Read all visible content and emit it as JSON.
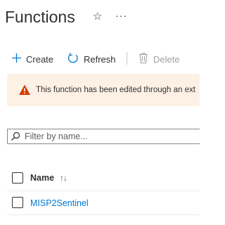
{
  "page": {
    "title": "Functions",
    "favorite_icon": "star-icon",
    "more_icon": "ellipsis-icon",
    "more_glyph": "···"
  },
  "toolbar": {
    "create_label": "Create",
    "refresh_label": "Refresh",
    "delete_label": "Delete",
    "delete_enabled": false
  },
  "banner": {
    "icon": "warning-icon",
    "text": "This function has been edited through an ext",
    "color": "#fdf1e5",
    "icon_color": "#d83b01"
  },
  "filter": {
    "placeholder": "Filter by name...",
    "value": ""
  },
  "table": {
    "columns": [
      {
        "label": "Name",
        "sort_icon": "sort-ascending-icon",
        "sort_glyph": "↑↓"
      }
    ],
    "rows": [
      {
        "name": "MISP2Sentinel",
        "checked": false
      }
    ]
  },
  "colors": {
    "accent": "#0078d4",
    "text": "#323130",
    "disabled": "#a19f9d"
  }
}
